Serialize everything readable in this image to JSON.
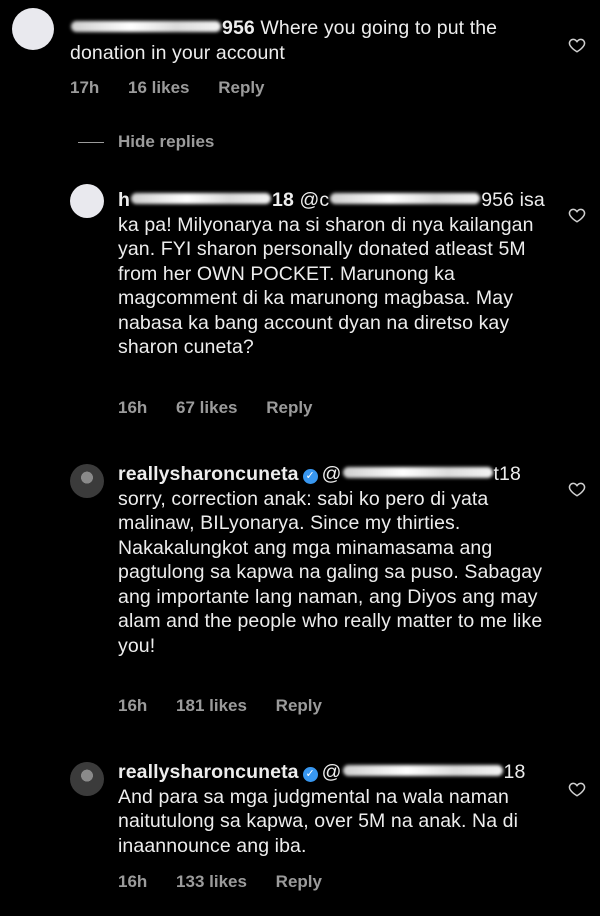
{
  "comments": [
    {
      "user_suffix": "956",
      "text": "Where you going to put the donation in your account",
      "time": "17h",
      "likes": "16 likes",
      "reply": "Reply"
    },
    {
      "user_suffix": "18",
      "mention_prefix": "@c",
      "mention_suffix": "956",
      "text": "isa ka pa! Milyonarya na si sharon di nya kailangan yan. FYI sharon personally donated atleast 5M from her OWN POCKET. Marunong ka magcomment di ka marunong magbasa. May nabasa ka bang account dyan na diretso kay sharon cuneta?",
      "time": "16h",
      "likes": "67 likes",
      "reply": "Reply"
    },
    {
      "user": "reallysharoncuneta",
      "mention_prefix": "@",
      "mention_suffix": "t18",
      "text": "sorry, correction anak: sabi ko pero di yata malinaw, BILyonarya. Since my thirties. Nakakalungkot ang mga minamasama ang pagtulong sa kapwa na galing sa puso. Sabagay ang importante lang naman, ang Diyos ang may alam and the people who really matter to me like you!",
      "time": "16h",
      "likes": "181 likes",
      "reply": "Reply"
    },
    {
      "user": "reallysharoncuneta",
      "mention_prefix": "@",
      "mention_suffix": "18",
      "text": "And para sa mga judgmental na wala naman naitutulong sa kapwa, over 5M na anak. Na di inaannounce ang iba.",
      "time": "16h",
      "likes": "133 likes",
      "reply": "Reply"
    }
  ],
  "hide_replies": "Hide replies"
}
